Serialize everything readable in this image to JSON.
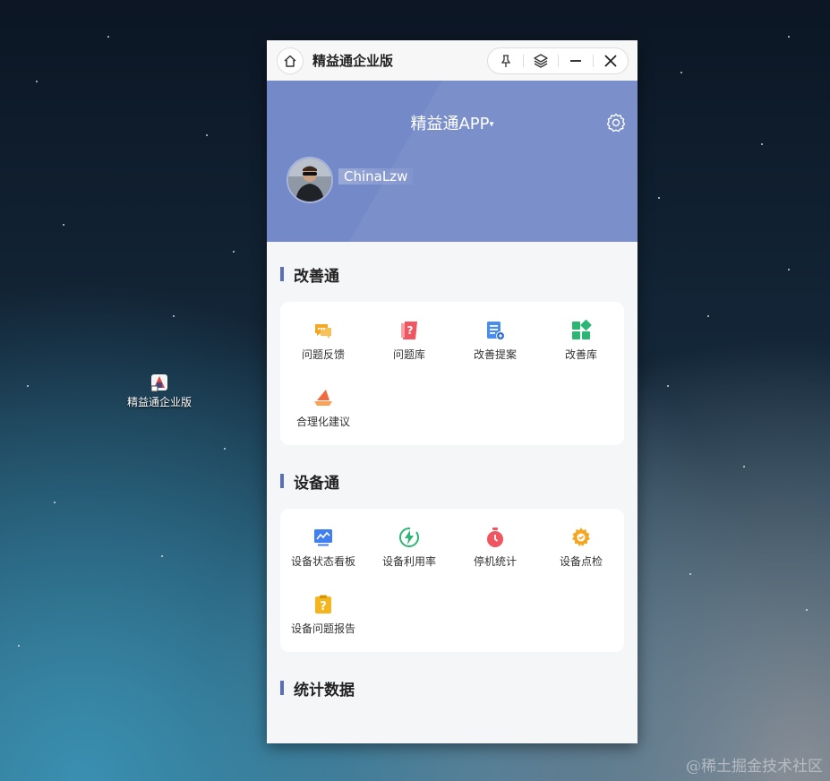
{
  "desktop": {
    "icon_label": "精益通企业版",
    "watermark": "@稀土掘金技术社区"
  },
  "window": {
    "title": "精益通企业版",
    "controls": [
      "pin-icon",
      "layers-icon",
      "minimize-icon",
      "close-icon"
    ]
  },
  "header": {
    "app_name": "精益通APP",
    "caret": "▾",
    "username": "ChinaLzw",
    "bg_color": "#7389c8"
  },
  "sections": [
    {
      "title": "改善通",
      "items": [
        {
          "label": "问题反馈",
          "icon": "chat-bubble-icon",
          "color": "#f5a623"
        },
        {
          "label": "问题库",
          "icon": "question-doc-icon",
          "color": "#f0565f"
        },
        {
          "label": "改善提案",
          "icon": "proposal-doc-icon",
          "color": "#4a8df0"
        },
        {
          "label": "改善库",
          "icon": "grid-blocks-icon",
          "color": "#2bb673"
        },
        {
          "label": "合理化建议",
          "icon": "sail-icon",
          "color": "#f26a3d"
        }
      ]
    },
    {
      "title": "设备通",
      "items": [
        {
          "label": "设备状态看板",
          "icon": "monitor-chart-icon",
          "color": "#3f7ff0"
        },
        {
          "label": "设备利用率",
          "icon": "lightning-circle-icon",
          "color": "#2bb673"
        },
        {
          "label": "停机统计",
          "icon": "stopwatch-icon",
          "color": "#f0565f"
        },
        {
          "label": "设备点检",
          "icon": "gear-check-icon",
          "color": "#f5a623"
        },
        {
          "label": "设备问题报告",
          "icon": "question-clipboard-icon",
          "color": "#f5b520"
        }
      ]
    },
    {
      "title": "统计数据",
      "items": []
    }
  ]
}
